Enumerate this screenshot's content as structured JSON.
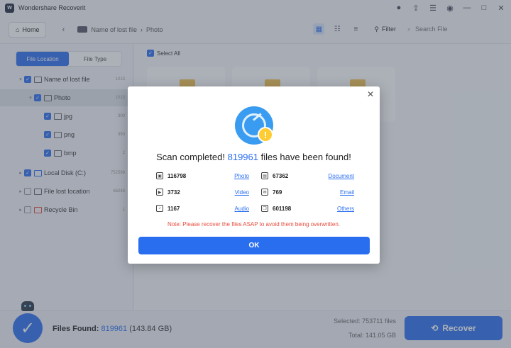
{
  "app": {
    "title": "Wondershare Recoverit"
  },
  "toolbar": {
    "home_label": "Home",
    "breadcrumb": [
      "Name of lost file",
      "Photo"
    ],
    "filter_label": "Filter",
    "search_placeholder": "Search File"
  },
  "sidebar": {
    "tabs": [
      "File Location",
      "File Type"
    ],
    "tree": [
      {
        "label": "Name of lost file",
        "count": "1013"
      },
      {
        "label": "Photo",
        "count": "1013"
      },
      {
        "label": "jpg",
        "count": "300"
      },
      {
        "label": "png",
        "count": "350"
      },
      {
        "label": "bmp",
        "count": "2"
      },
      {
        "label": "Local Disk (C:)",
        "count": "752598"
      },
      {
        "label": "File lost location",
        "count": "66248"
      },
      {
        "label": "Recycle Bin",
        "count": "1"
      }
    ]
  },
  "main": {
    "select_all_label": "Select All"
  },
  "dialog": {
    "title_prefix": "Scan completed!",
    "title_count": "819961",
    "title_suffix": "files have been found!",
    "stats": [
      {
        "count": "116798",
        "label": "Photo",
        "icon": "image-icon"
      },
      {
        "count": "67362",
        "label": "Document",
        "icon": "document-icon"
      },
      {
        "count": "3732",
        "label": "Video",
        "icon": "video-icon"
      },
      {
        "count": "769",
        "label": "Email",
        "icon": "email-icon"
      },
      {
        "count": "1167",
        "label": "Audio",
        "icon": "audio-icon"
      },
      {
        "count": "601198",
        "label": "Others",
        "icon": "others-icon"
      }
    ],
    "note": "Note: Please recover the files ASAP to avoid them being overwritten.",
    "ok_label": "OK",
    "close_glyph": "✕"
  },
  "status": {
    "files_found_label": "Files Found:",
    "files_found_count": "819961",
    "files_found_size": "(143.84 GB)",
    "selected_text": "Selected: 753711 files",
    "total_text": "Total: 141.05 GB",
    "recover_label": "Recover"
  },
  "colors": {
    "accent": "#2a6ef0",
    "warning": "#e64c3c",
    "overlay": "#46505f"
  }
}
